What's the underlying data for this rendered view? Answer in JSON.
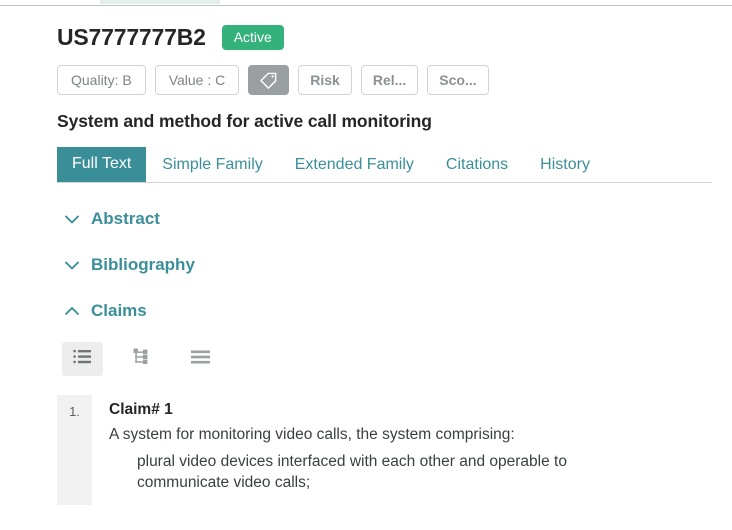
{
  "header": {
    "patent_number": "US7777777B2",
    "status_badge": "Active"
  },
  "chips": [
    {
      "label": "Quality: B",
      "style": "outline",
      "icon": null,
      "name": "quality-chip"
    },
    {
      "label": "Value : C",
      "style": "outline",
      "icon": null,
      "name": "value-chip"
    },
    {
      "label": "",
      "style": "filled-icon",
      "icon": "tag-icon",
      "name": "tag-button"
    },
    {
      "label": "Risk",
      "style": "outline-bold",
      "icon": null,
      "name": "risk-chip"
    },
    {
      "label": "Rel...",
      "style": "outline-bold",
      "icon": null,
      "name": "relevance-chip"
    },
    {
      "label": "Sco...",
      "style": "outline-bold",
      "icon": null,
      "name": "score-chip"
    }
  ],
  "document": {
    "title": "System and method for active call monitoring"
  },
  "tabs": [
    {
      "label": "Full Text",
      "active": true
    },
    {
      "label": "Simple Family",
      "active": false
    },
    {
      "label": "Extended Family",
      "active": false
    },
    {
      "label": "Citations",
      "active": false
    },
    {
      "label": "History",
      "active": false
    }
  ],
  "sections": [
    {
      "label": "Abstract",
      "expanded": false,
      "chevron": "chevron-down-icon"
    },
    {
      "label": "Bibliography",
      "expanded": false,
      "chevron": "chevron-down-icon"
    },
    {
      "label": "Claims",
      "expanded": true,
      "chevron": "chevron-up-icon"
    }
  ],
  "claims_toolbar": [
    {
      "icon": "list-view-icon",
      "active": true
    },
    {
      "icon": "tree-view-icon",
      "active": false
    },
    {
      "icon": "paragraph-view-icon",
      "active": false
    }
  ],
  "claims": [
    {
      "index": "1.",
      "title": "Claim# 1",
      "preamble": "A system for monitoring video calls, the system comprising:",
      "element": "plural video devices interfaced with each other and operable to communicate video calls;"
    }
  ],
  "colors": {
    "teal": "#3a8e98",
    "teal_text": "#3b8f99",
    "green": "#34b27b",
    "chip_grey": "#9a9fa1",
    "index_bg": "#f1f1f1"
  }
}
